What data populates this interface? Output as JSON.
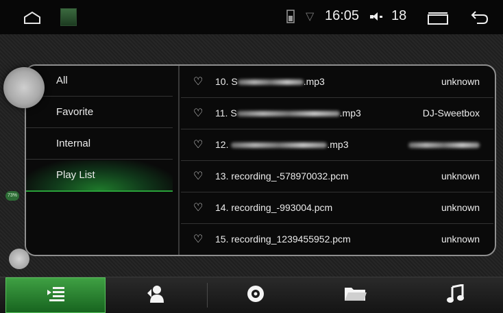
{
  "statusbar": {
    "time": "16:05",
    "volume": "18"
  },
  "sidebar": {
    "items": [
      {
        "label": "All",
        "active": false
      },
      {
        "label": "Favorite",
        "active": false
      },
      {
        "label": "Internal",
        "active": false
      },
      {
        "label": "Play List",
        "active": true
      }
    ]
  },
  "tracks": [
    {
      "prefix": "10. S",
      "suffix": ".mp3",
      "artist": "unknown"
    },
    {
      "prefix": "11. S",
      "suffix": ".mp3",
      "artist": "DJ-Sweetbox"
    },
    {
      "prefix": "12. ",
      "suffix": ".mp3",
      "artist": ""
    },
    {
      "prefix": "13. recording_-578970032.pcm",
      "suffix": "",
      "artist": "unknown"
    },
    {
      "prefix": "14. recording_-993004.pcm",
      "suffix": "",
      "artist": "unknown"
    },
    {
      "prefix": "15. recording_1239455952.pcm",
      "suffix": "",
      "artist": "unknown"
    }
  ],
  "assist": {
    "percent": "73%"
  },
  "bottom_tabs": [
    {
      "icon": "playlist-icon",
      "active": true
    },
    {
      "icon": "artist-icon",
      "active": false
    },
    {
      "icon": "album-icon",
      "active": false
    },
    {
      "icon": "folder-icon",
      "active": false
    },
    {
      "icon": "music-note-icon",
      "active": false
    }
  ],
  "colors": {
    "accent": "#2aa23a",
    "background": "#0a0a0a"
  }
}
